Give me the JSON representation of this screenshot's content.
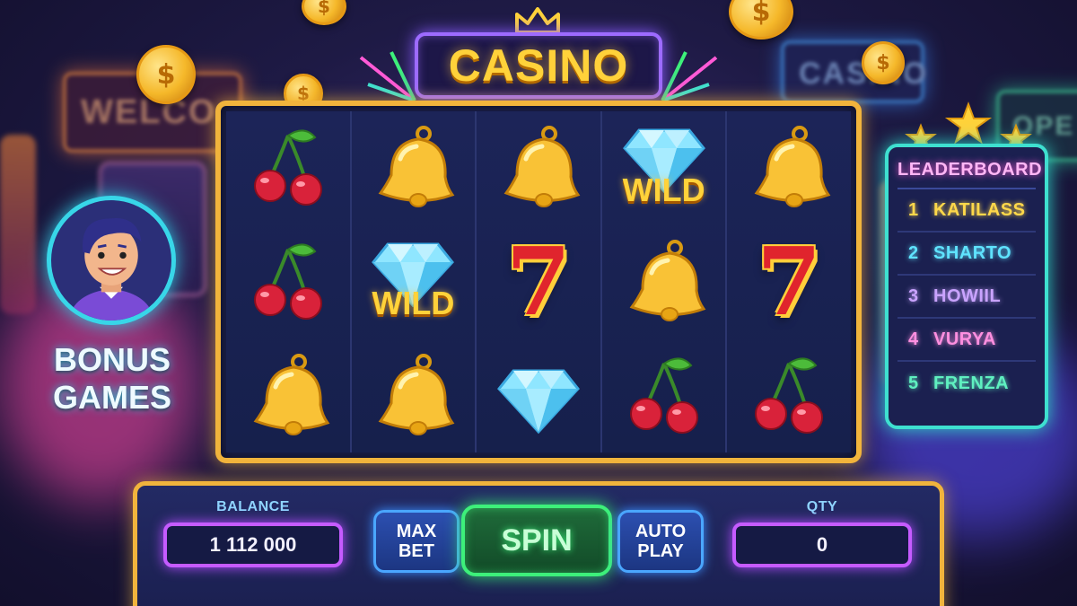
{
  "marquee": {
    "title": "CASINO"
  },
  "background": {
    "welcome_sign": "WELCO",
    "casino_sign": "CASINO",
    "open_sign": "OPE"
  },
  "coin_symbol": "$",
  "reels": [
    [
      {
        "symbol": "cherry"
      },
      {
        "symbol": "cherry"
      },
      {
        "symbol": "bell"
      }
    ],
    [
      {
        "symbol": "bell"
      },
      {
        "symbol": "diamond",
        "label": "WILD"
      },
      {
        "symbol": "bell"
      }
    ],
    [
      {
        "symbol": "bell"
      },
      {
        "symbol": "seven",
        "label": "7"
      },
      {
        "symbol": "diamond"
      }
    ],
    [
      {
        "symbol": "diamond",
        "label": "WILD"
      },
      {
        "symbol": "bell"
      },
      {
        "symbol": "cherry"
      }
    ],
    [
      {
        "symbol": "bell"
      },
      {
        "symbol": "seven",
        "label": "7"
      },
      {
        "symbol": "cherry"
      }
    ]
  ],
  "bonus": {
    "label_line1": "BONUS",
    "label_line2": "GAMES"
  },
  "leaderboard": {
    "title": "LEADERBOARD",
    "entries": [
      {
        "rank": "1",
        "name": "KATILASS",
        "color": "#ffd84a"
      },
      {
        "rank": "2",
        "name": "SHARTO",
        "color": "#5fe3ff"
      },
      {
        "rank": "3",
        "name": "HOWIIL",
        "color": "#c9a3ff"
      },
      {
        "rank": "4",
        "name": "VURYA",
        "color": "#ff8fe0"
      },
      {
        "rank": "5",
        "name": "FRENZA",
        "color": "#5ff0c0"
      }
    ]
  },
  "controls": {
    "balance_label": "BALANCE",
    "balance_value": "1 112 000",
    "max_bet_line1": "MAX",
    "max_bet_line2": "BET",
    "spin_label": "SPIN",
    "auto_play_line1": "AUTO",
    "auto_play_line2": "PLAY",
    "qty_label": "QTY",
    "qty_value": "0"
  },
  "colors": {
    "gold": "#f1b43c",
    "neon_purple": "#c55bff",
    "neon_green": "#3df07a",
    "neon_cyan": "#3ee0d0"
  }
}
